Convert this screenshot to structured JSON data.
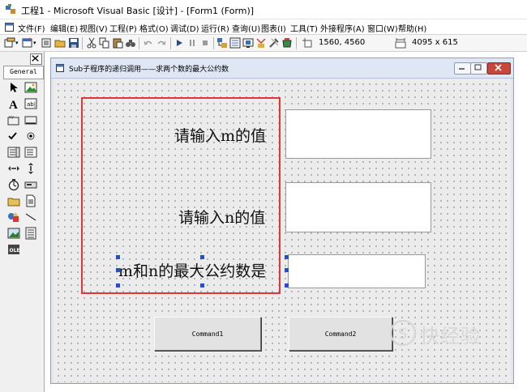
{
  "window": {
    "title": "工程1 - Microsoft Visual Basic [设计] - [Form1 (Form)]"
  },
  "menu": {
    "items": [
      "文件(F)",
      "编辑(E)",
      "视图(V)",
      "工程(P)",
      "格式(O)",
      "调试(D)",
      "运行(R)",
      "查询(U)",
      "图表(I)",
      "工具(T)",
      "外接程序(A)",
      "窗口(W)",
      "帮助(H)"
    ]
  },
  "toolbar": {
    "position": "1560, 4560",
    "size": "4095 x 615"
  },
  "toolbox": {
    "tab_label": "General"
  },
  "form": {
    "caption": "Sub子程序的递归调用——求两个数的最大公约数",
    "labels": {
      "m_prompt": "请输入m的值",
      "n_prompt": "请输入n的值",
      "gcd_prompt": "m和n的最大公约数是"
    },
    "buttons": {
      "command1": "Command1",
      "command2": "Command2"
    }
  },
  "watermark": {
    "text": "快经验",
    "sub": ""
  },
  "colors": {
    "highlight": "#e0363a",
    "handle": "#1f4fd6",
    "caption_bg": "#dee7f3",
    "close": "#c7473a"
  }
}
